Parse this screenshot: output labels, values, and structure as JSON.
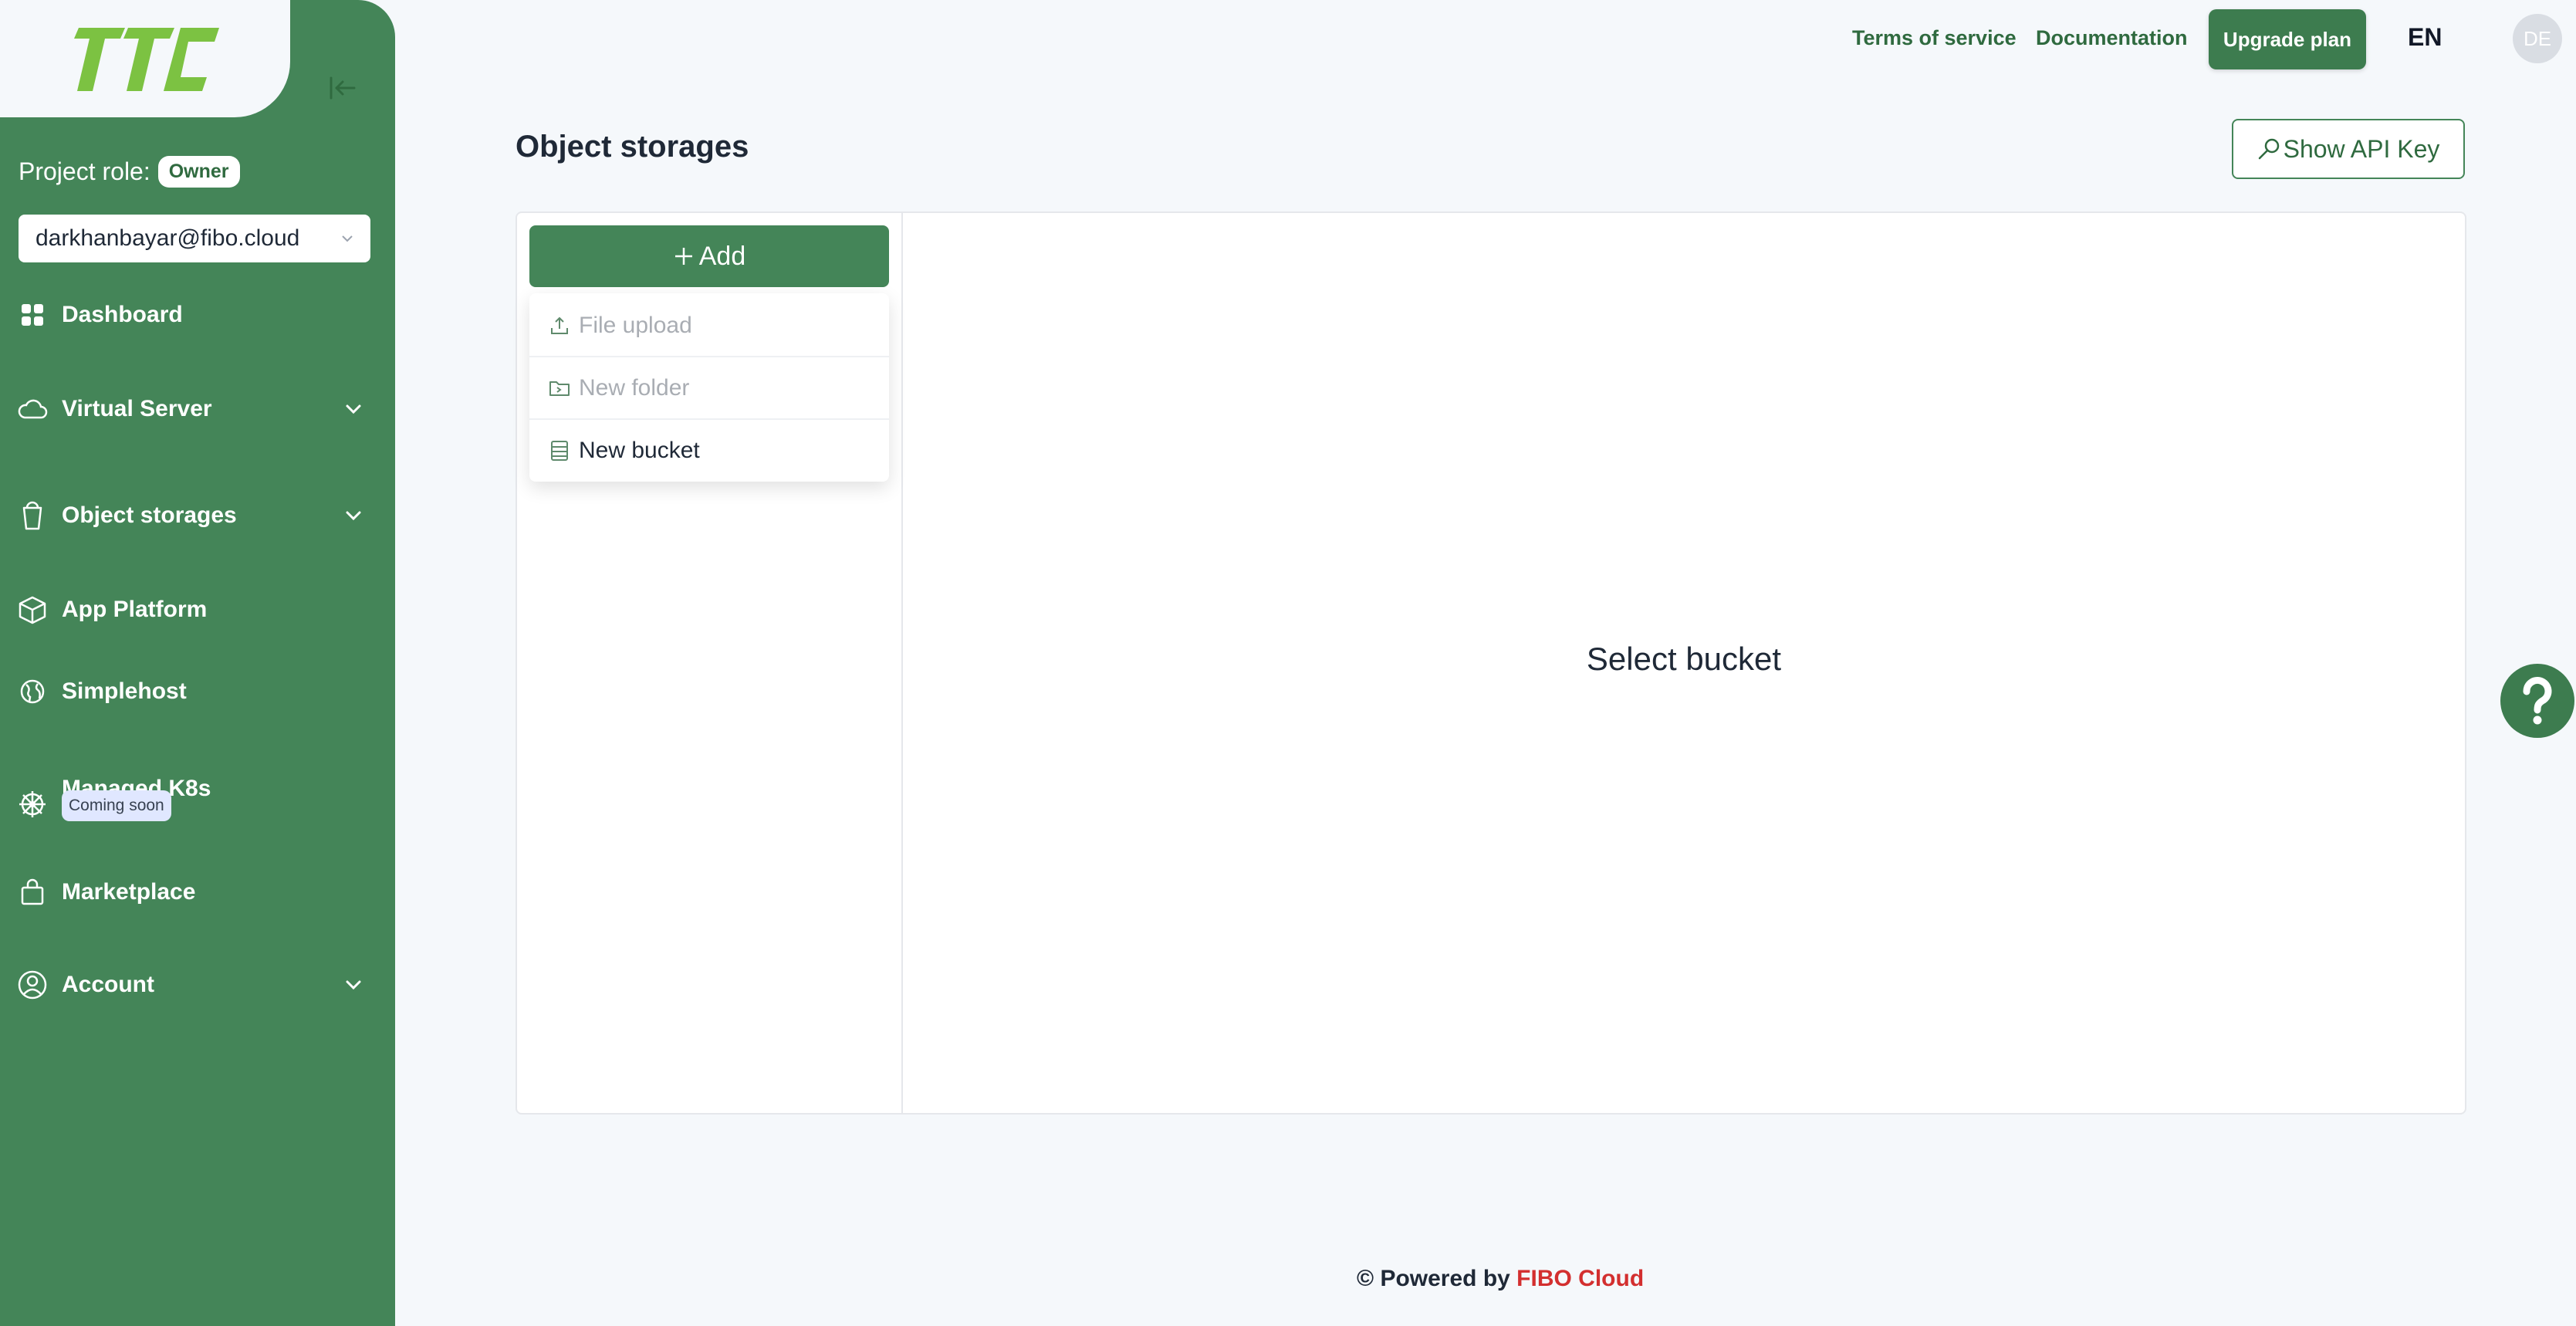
{
  "sidebar": {
    "project_role_label": "Project role:",
    "project_role_value": "Owner",
    "user_email": "darkhanbayar@fibo.cloud",
    "items": [
      {
        "label": "Dashboard",
        "icon": "grid-icon"
      },
      {
        "label": "Virtual Server",
        "icon": "cloud-icon",
        "expandable": true
      },
      {
        "label": "Object storages",
        "icon": "bucket-icon",
        "expandable": true
      },
      {
        "label": "App Platform",
        "icon": "cube-icon"
      },
      {
        "label": "Simplehost",
        "icon": "globe-icon"
      },
      {
        "label": "Managed K8s",
        "icon": "helm-icon",
        "badge": "Coming soon"
      },
      {
        "label": "Marketplace",
        "icon": "bag-icon"
      },
      {
        "label": "Account",
        "icon": "user-circle-icon",
        "expandable": true
      }
    ]
  },
  "header": {
    "terms": "Terms of service",
    "docs": "Documentation",
    "upgrade": "Upgrade plan",
    "lang": "EN",
    "avatar_initials": "DE"
  },
  "main": {
    "title": "Object storages",
    "api_button": "Show API Key",
    "add_button": "Add",
    "menu": [
      {
        "label": "File upload",
        "icon": "upload-icon",
        "disabled": true
      },
      {
        "label": "New folder",
        "icon": "folder-plus-icon",
        "disabled": true
      },
      {
        "label": "New bucket",
        "icon": "bucket-list-icon",
        "disabled": false
      }
    ],
    "empty_message": "Select bucket"
  },
  "footer": {
    "prefix": "© Powered by",
    "brand": "FIBO Cloud"
  },
  "colors": {
    "sidebar": "#448558",
    "primary_button": "#3d7c4f",
    "brand_red": "#d32f2f",
    "logo_green": "#7cc242"
  }
}
